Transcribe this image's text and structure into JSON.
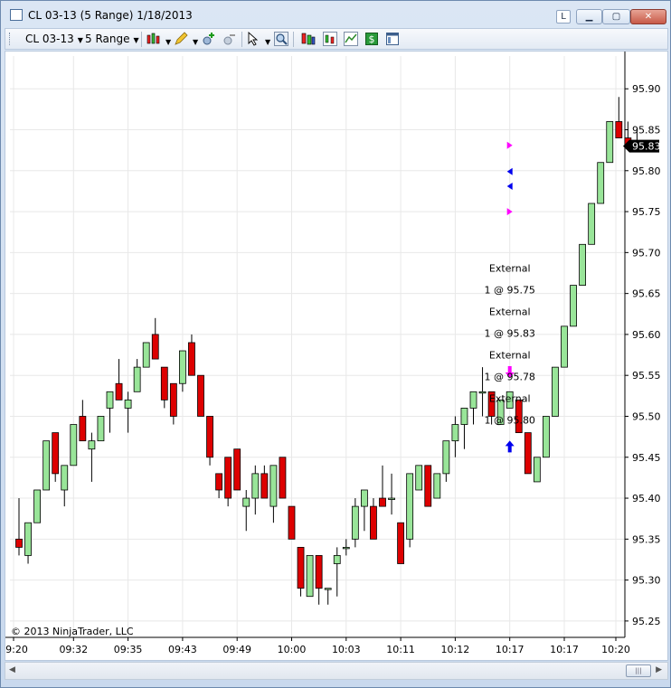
{
  "window": {
    "title": "CL 03-13 (5 Range)  1/18/2013",
    "btn_l": "L"
  },
  "toolbar": {
    "instrument": "CL 03-13",
    "period": "5 Range",
    "icons": [
      "bar-style-icon",
      "drawing-pencil-icon",
      "zoom-in-icon",
      "zoom-out-icon",
      "pointer-icon",
      "magnifier-icon",
      "data-box-icon",
      "indicators-icon",
      "strategies-icon",
      "orders-icon",
      "properties-icon"
    ]
  },
  "colors": {
    "up": "#99e599",
    "down": "#dd0000",
    "wick": "#000000",
    "grid": "#e8e8e8",
    "last_price_bg": "#000000",
    "marker_magenta": "#ff00ff",
    "marker_blue": "#0000ee"
  },
  "chart_data": {
    "type": "candlestick",
    "y_range": [
      95.23,
      95.94
    ],
    "y_ticks": [
      "95.90",
      "95.85",
      "95.80",
      "95.75",
      "95.70",
      "95.65",
      "95.60",
      "95.55",
      "95.50",
      "95.45",
      "95.40",
      "95.35",
      "95.30",
      "95.25"
    ],
    "x_labels": [
      "09:20",
      "09:32",
      "09:35",
      "09:43",
      "09:49",
      "10:00",
      "10:03",
      "10:11",
      "10:12",
      "10:17",
      "10:17",
      "10:20"
    ],
    "last_price": "95.83",
    "copyright": "© 2013 NinjaTrader, LLC",
    "bars": [
      [
        95.35,
        95.4,
        95.33,
        95.34
      ],
      [
        95.33,
        95.37,
        95.32,
        95.37
      ],
      [
        95.37,
        95.41,
        95.37,
        95.41
      ],
      [
        95.41,
        95.47,
        95.41,
        95.47
      ],
      [
        95.48,
        95.48,
        95.42,
        95.43
      ],
      [
        95.41,
        95.44,
        95.39,
        95.44
      ],
      [
        95.44,
        95.49,
        95.44,
        95.49
      ],
      [
        95.5,
        95.52,
        95.47,
        95.47
      ],
      [
        95.46,
        95.48,
        95.42,
        95.47
      ],
      [
        95.47,
        95.5,
        95.47,
        95.5
      ],
      [
        95.51,
        95.53,
        95.48,
        95.53
      ],
      [
        95.54,
        95.57,
        95.52,
        95.52
      ],
      [
        95.51,
        95.53,
        95.48,
        95.52
      ],
      [
        95.53,
        95.57,
        95.53,
        95.56
      ],
      [
        95.56,
        95.59,
        95.56,
        95.59
      ],
      [
        95.6,
        95.62,
        95.57,
        95.57
      ],
      [
        95.56,
        95.56,
        95.51,
        95.52
      ],
      [
        95.54,
        95.54,
        95.49,
        95.5
      ],
      [
        95.54,
        95.58,
        95.53,
        95.58
      ],
      [
        95.59,
        95.6,
        95.55,
        95.55
      ],
      [
        95.55,
        95.55,
        95.5,
        95.5
      ],
      [
        95.5,
        95.5,
        95.44,
        95.45
      ],
      [
        95.43,
        95.43,
        95.4,
        95.41
      ],
      [
        95.45,
        95.45,
        95.39,
        95.4
      ],
      [
        95.46,
        95.46,
        95.41,
        95.41
      ],
      [
        95.39,
        95.41,
        95.36,
        95.4
      ],
      [
        95.4,
        95.44,
        95.38,
        95.43
      ],
      [
        95.43,
        95.44,
        95.4,
        95.4
      ],
      [
        95.39,
        95.44,
        95.37,
        95.44
      ],
      [
        95.45,
        95.45,
        95.4,
        95.4
      ],
      [
        95.39,
        95.39,
        95.35,
        95.35
      ],
      [
        95.34,
        95.34,
        95.28,
        95.29
      ],
      [
        95.28,
        95.33,
        95.28,
        95.33
      ],
      [
        95.33,
        95.33,
        95.27,
        95.29
      ],
      [
        95.29,
        95.29,
        95.27,
        95.29
      ],
      [
        95.32,
        95.34,
        95.28,
        95.33
      ],
      [
        95.34,
        95.35,
        95.33,
        95.34
      ],
      [
        95.35,
        95.4,
        95.34,
        95.39
      ],
      [
        95.39,
        95.41,
        95.36,
        95.41
      ],
      [
        95.39,
        95.4,
        95.35,
        95.35
      ],
      [
        95.4,
        95.44,
        95.4,
        95.39
      ],
      [
        95.4,
        95.43,
        95.38,
        95.4
      ],
      [
        95.37,
        95.37,
        95.32,
        95.32
      ],
      [
        95.35,
        95.43,
        95.34,
        95.43
      ],
      [
        95.41,
        95.44,
        95.41,
        95.44
      ],
      [
        95.44,
        95.44,
        95.39,
        95.39
      ],
      [
        95.4,
        95.43,
        95.4,
        95.43
      ],
      [
        95.43,
        95.47,
        95.42,
        95.47
      ],
      [
        95.47,
        95.5,
        95.45,
        95.49
      ],
      [
        95.49,
        95.51,
        95.46,
        95.51
      ],
      [
        95.51,
        95.53,
        95.49,
        95.53
      ],
      [
        95.53,
        95.56,
        95.5,
        95.53
      ],
      [
        95.53,
        95.53,
        95.49,
        95.5
      ],
      [
        95.49,
        95.52,
        95.49,
        95.52
      ],
      [
        95.51,
        95.53,
        95.51,
        95.53
      ],
      [
        95.52,
        95.52,
        95.48,
        95.48
      ],
      [
        95.48,
        95.48,
        95.43,
        95.43
      ],
      [
        95.42,
        95.45,
        95.42,
        95.45
      ],
      [
        95.45,
        95.5,
        95.45,
        95.5
      ],
      [
        95.5,
        95.56,
        95.5,
        95.56
      ],
      [
        95.56,
        95.61,
        95.56,
        95.61
      ],
      [
        95.61,
        95.66,
        95.61,
        95.66
      ],
      [
        95.66,
        95.71,
        95.66,
        95.71
      ],
      [
        95.71,
        95.76,
        95.71,
        95.76
      ],
      [
        95.76,
        95.81,
        95.76,
        95.81
      ],
      [
        95.81,
        95.86,
        95.81,
        95.86
      ],
      [
        95.86,
        95.89,
        95.84,
        95.84
      ],
      [
        95.84,
        95.86,
        95.83,
        95.83
      ],
      [
        95.83,
        95.85,
        95.83,
        95.83
      ]
    ],
    "signal_text": [
      "External",
      "1 @ 95.75",
      "External",
      "1 @ 95.83",
      "External",
      "1 @ 95.78",
      "External",
      "1 @ 95.80"
    ],
    "markers": [
      {
        "bar": 54,
        "price": 95.831,
        "shape": "tri-right",
        "color": "magenta"
      },
      {
        "bar": 54,
        "price": 95.799,
        "shape": "tri-left",
        "color": "blue"
      },
      {
        "bar": 54,
        "price": 95.781,
        "shape": "tri-left",
        "color": "blue"
      },
      {
        "bar": 54,
        "price": 95.75,
        "shape": "tri-right",
        "color": "magenta"
      },
      {
        "bar": 54,
        "price": 95.548,
        "shape": "arrow-down",
        "color": "magenta"
      },
      {
        "bar": 54,
        "price": 95.467,
        "shape": "arrow-up",
        "color": "blue"
      }
    ]
  }
}
